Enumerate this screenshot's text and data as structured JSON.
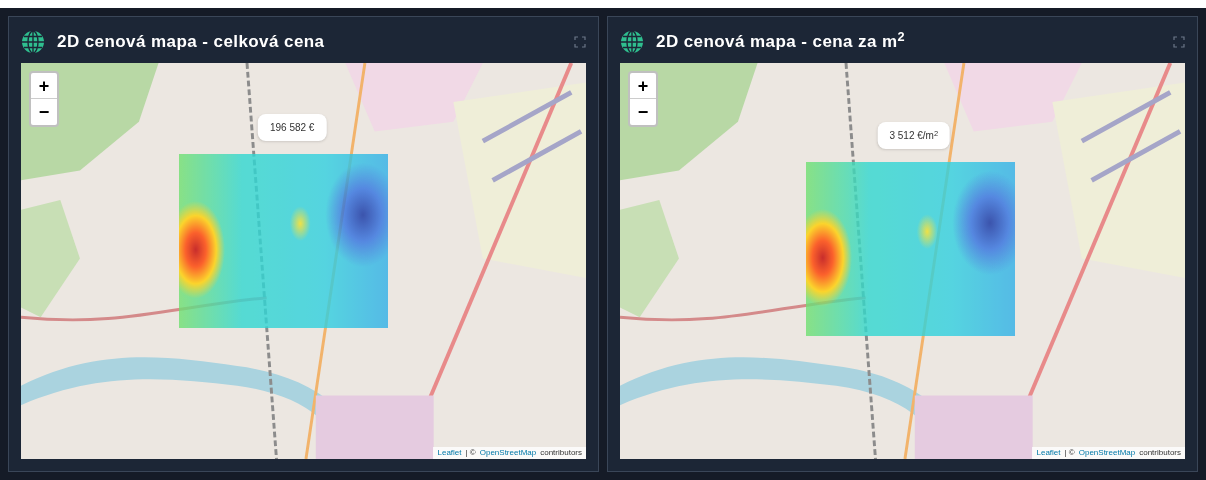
{
  "panels": [
    {
      "title": "2D cenová mapa - celková cena",
      "zoom_in": "+",
      "zoom_out": "−",
      "tooltip": "196 582 €",
      "attribution": {
        "leaflet": "Leaflet",
        "separator": "| ©",
        "osm": "OpenStreetMap",
        "suffix": "contributors"
      }
    },
    {
      "title": "2D cenová mapa - cena za m$^{2}$",
      "zoom_in": "+",
      "zoom_out": "−",
      "tooltip": "3 512 €/m$^{2}$",
      "attribution": {
        "leaflet": "Leaflet",
        "separator": "| ©",
        "osm": "OpenStreetMap",
        "suffix": "contributors"
      }
    }
  ]
}
